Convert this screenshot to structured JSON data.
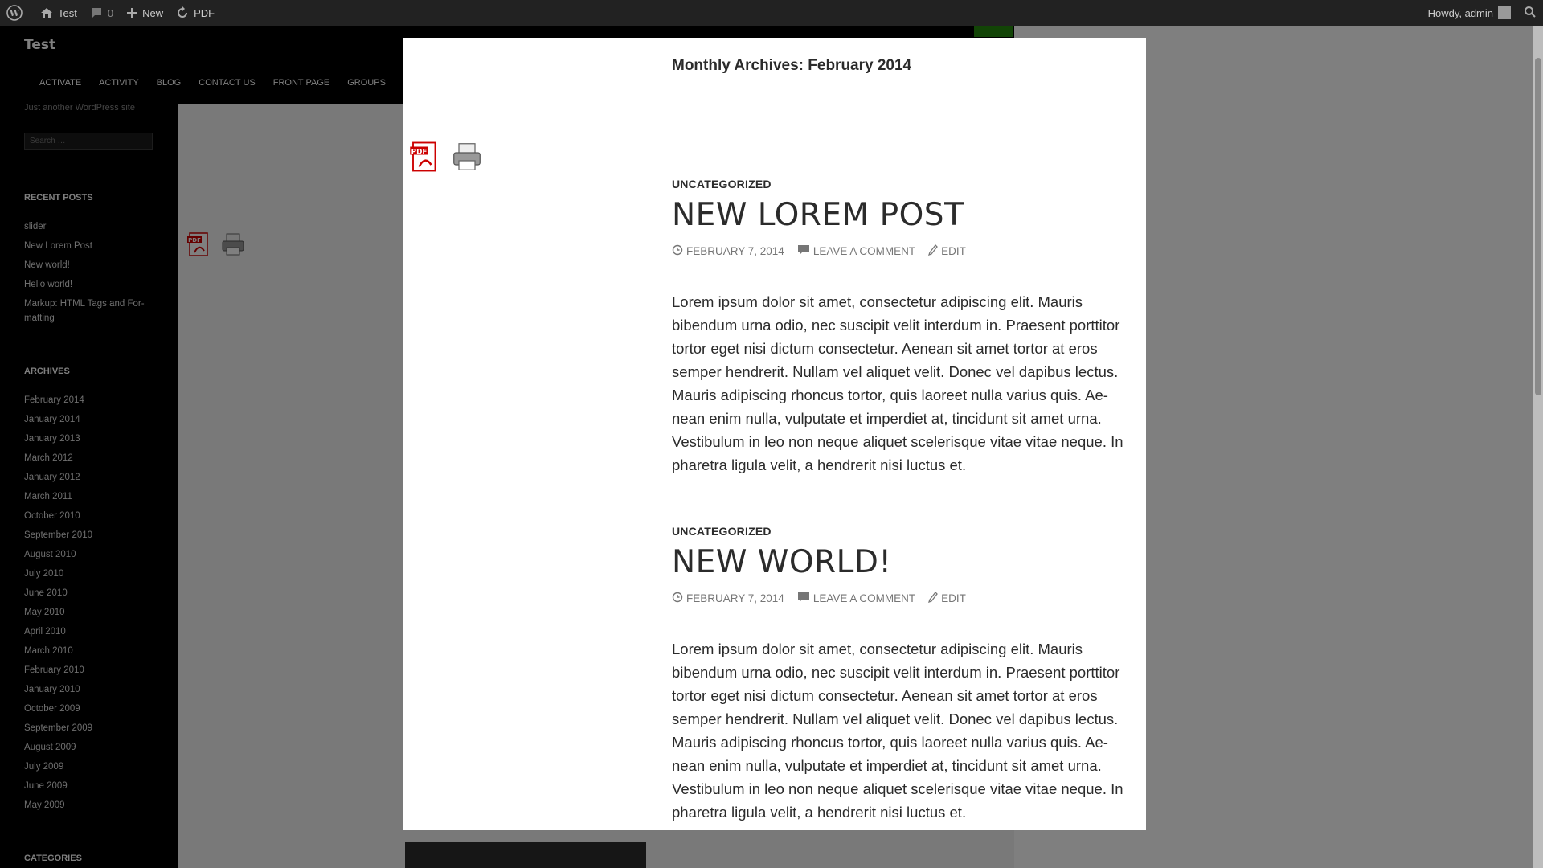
{
  "adminbar": {
    "site_name": "Test",
    "comments_count": "0",
    "new_label": "New",
    "pdf_label": "PDF",
    "howdy": "Howdy, admin"
  },
  "site": {
    "title": "Test",
    "tagline": "Just another WordPress site",
    "search_placeholder": "Search …"
  },
  "nav": [
    "ACTIVATE",
    "ACTIVITY",
    "BLOG",
    "CONTACT US",
    "FRONT PAGE",
    "GROUPS"
  ],
  "recent_posts": {
    "title": "RECENT POSTS",
    "items": [
      "slider",
      "New Lorem Post",
      "New world!",
      "Hello world!",
      "Markup: HTML Tags and For-matting"
    ]
  },
  "archives": {
    "title": "ARCHIVES",
    "items": [
      "February 2014",
      "January 2014",
      "January 2013",
      "March 2012",
      "January 2012",
      "March 2011",
      "October 2010",
      "September 2010",
      "August 2010",
      "July 2010",
      "June 2010",
      "May 2010",
      "April 2010",
      "March 2010",
      "February 2010",
      "January 2010",
      "October 2009",
      "September 2009",
      "August 2009",
      "July 2009",
      "June 2009",
      "May 2009"
    ]
  },
  "categories": {
    "title": "CATEGORIES"
  },
  "modal": {
    "archive_title": "Monthly Archives: February 2014",
    "posts": [
      {
        "category": "UNCATEGORIZED",
        "title": "NEW LOREM POST",
        "date": "FEBRUARY 7, 2014",
        "comment": "LEAVE A COMMENT",
        "edit": "EDIT",
        "excerpt": "Lorem ipsum dolor sit amet, consectetur adipiscing elit. Mauris bibendum urna odio, nec suscipit velit interdum in. Praesent porttitor tortor eget nisi dictum consectetur. Aenean sit amet tortor at eros semper hendrerit. Nullam vel aliquet velit. Donec vel dapibus lectus. Mauris adipiscing rhoncus tortor, quis laoreet nulla varius quis. Ae-nean enim nulla, vulputate et imperdiet at, tincidunt sit amet urna. Vestibulum in leo non neque aliquet scelerisque vitae vitae neque. In pharetra ligula velit, a hendrerit nisi luctus et."
      },
      {
        "category": "UNCATEGORIZED",
        "title": "NEW WORLD!",
        "date": "FEBRUARY 7, 2014",
        "comment": "LEAVE A COMMENT",
        "edit": "EDIT",
        "excerpt": "Lorem ipsum dolor sit amet, consectetur adipiscing elit. Mauris bibendum urna odio, nec suscipit velit interdum in. Praesent porttitor tortor eget nisi dictum consectetur. Aenean sit amet tortor at eros semper hendrerit. Nullam vel aliquet velit. Donec vel dapibus lectus. Mauris adipiscing rhoncus tortor, quis laoreet nulla varius quis. Ae-nean enim nulla, vulputate et imperdiet at, tincidunt sit amet urna. Vestibulum in leo non neque aliquet scelerisque vitae vitae neque. In pharetra ligula velit, a hendrerit nisi luctus et."
      }
    ]
  },
  "colors": {
    "adminbar": "#222222",
    "accent_green": "#24890d",
    "sidebar": "#000000"
  },
  "icons": {
    "wp": "wordpress-logo-icon",
    "home": "home-icon",
    "comment": "comment-icon",
    "plus": "plus-icon",
    "pdf": "pdf-icon",
    "print": "printer-icon",
    "search": "search-icon",
    "clock": "clock-icon",
    "pencil": "pencil-icon"
  }
}
